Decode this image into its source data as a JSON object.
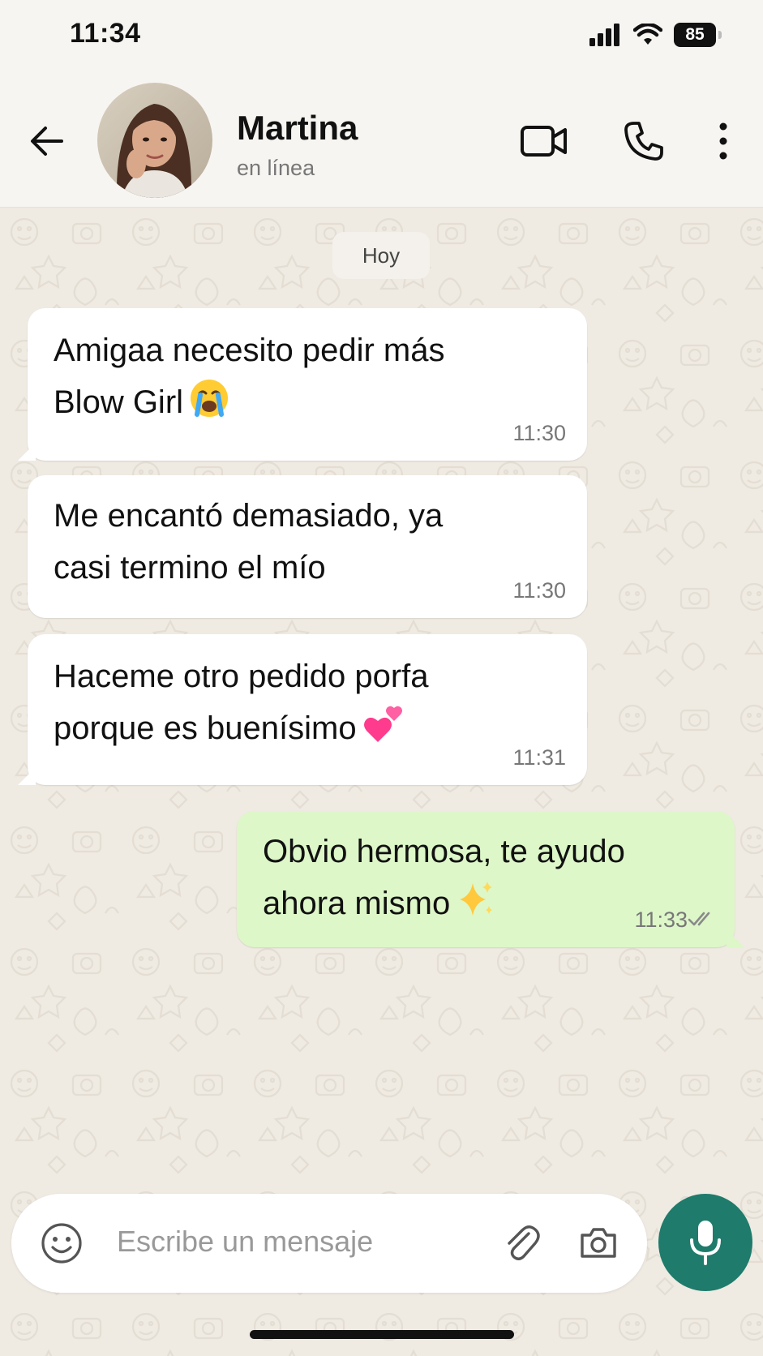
{
  "status_bar": {
    "time": "11:34",
    "battery": "85"
  },
  "header": {
    "contact_name": "Martina",
    "contact_status": "en línea"
  },
  "chat": {
    "date_chip": "Hoy",
    "messages": [
      {
        "direction": "in",
        "lines": [
          "Amigaa necesito pedir más",
          "Blow Girl"
        ],
        "emoji": "loudly-crying-face",
        "time": "11:30"
      },
      {
        "direction": "in",
        "lines": [
          "Me encantó demasiado, ya",
          "casi termino el mío"
        ],
        "time": "11:30"
      },
      {
        "direction": "in",
        "lines": [
          "Haceme otro pedido porfa",
          "porque es buenísimo"
        ],
        "emoji": "two-hearts",
        "time": "11:31"
      },
      {
        "direction": "out",
        "lines": [
          "Obvio hermosa, te ayudo",
          "ahora mismo"
        ],
        "emoji": "sparkles",
        "time": "11:33",
        "status": "read-double-check"
      }
    ]
  },
  "composer": {
    "placeholder": "Escribe un mensaje"
  },
  "colors": {
    "header_bg": "#f7f5f1",
    "chat_bg": "#efeae2",
    "incoming_bubble": "#ffffff",
    "outgoing_bubble": "#ddf7c8",
    "mic_button": "#1f7b6b",
    "meta_text": "#777777"
  },
  "icons": [
    "back-arrow-icon",
    "video-call-icon",
    "phone-call-icon",
    "more-options-icon",
    "emoji-icon",
    "attach-icon",
    "camera-icon",
    "mic-icon",
    "double-check-icon",
    "signal-icon",
    "wifi-icon",
    "battery-icon"
  ]
}
